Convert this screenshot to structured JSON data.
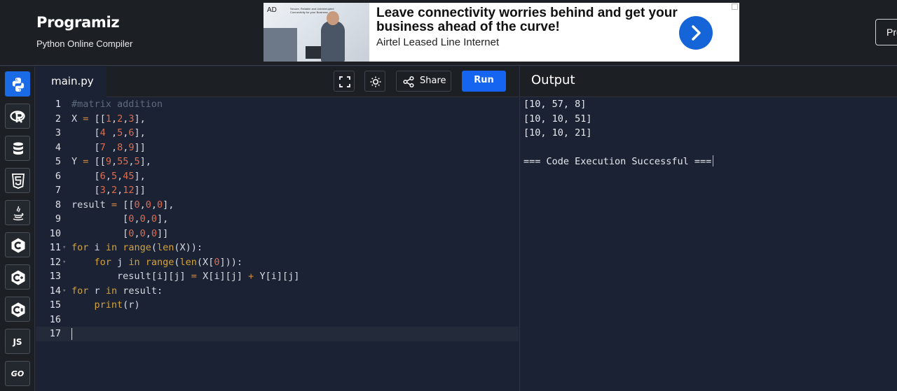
{
  "header": {
    "logo": "Programiz",
    "subtitle": "Python Online Compiler",
    "pro_button": "Pro"
  },
  "ad": {
    "tag": "AD",
    "headline": "Leave connectivity worries behind and get your business ahead of the curve!",
    "subline": "Airtel Leased Line Internet",
    "image_text": "Secure, Reliable and Uninterrupted Connectivity for your Business"
  },
  "sidebar": {
    "items": [
      {
        "name": "python",
        "icon": "python-icon",
        "label": ""
      },
      {
        "name": "r",
        "icon": "r-icon",
        "label": ""
      },
      {
        "name": "sql",
        "icon": "database-icon",
        "label": ""
      },
      {
        "name": "html",
        "icon": "html5-icon",
        "label": ""
      },
      {
        "name": "java",
        "icon": "java-icon",
        "label": ""
      },
      {
        "name": "c",
        "icon": "c-icon",
        "label": ""
      },
      {
        "name": "cpp",
        "icon": "cpp-icon",
        "label": ""
      },
      {
        "name": "csharp",
        "icon": "csharp-icon",
        "label": ""
      },
      {
        "name": "js",
        "icon": "js-icon",
        "label": "JS"
      },
      {
        "name": "go",
        "icon": "go-icon",
        "label": "GO"
      }
    ]
  },
  "editor": {
    "file_tab": "main.py",
    "share_label": "Share",
    "run_label": "Run",
    "line_numbers": [
      "1",
      "2",
      "3",
      "4",
      "5",
      "6",
      "7",
      "8",
      "9",
      "10",
      "11",
      "12",
      "13",
      "14",
      "15",
      "16",
      "17"
    ],
    "code_lines": [
      "#matrix addition",
      "X = [[1,2,3],",
      "    [4 ,5,6],",
      "    [7 ,8,9]]",
      "Y = [[9,55,5],",
      "    [6,5,45],",
      "    [3,2,12]]",
      "result = [[0,0,0],",
      "         [0,0,0],",
      "         [0,0,0]]",
      "for i in range(len(X)):",
      "    for j in range(len(X[0])):",
      "        result[i][j] = X[i][j] + Y[i][j]",
      "for r in result:",
      "    print(r)",
      "",
      ""
    ],
    "fold_lines": [
      11,
      12,
      14
    ],
    "current_line": 17
  },
  "output": {
    "title": "Output",
    "lines": [
      "[10, 57, 8]",
      "[10, 10, 51]",
      "[10, 10, 21]",
      "",
      "=== Code Execution Successful ==="
    ]
  },
  "colors": {
    "comment": "#5f6b7f",
    "keyword": "#d4a23a",
    "number": "#e06c50",
    "operator": "#d88a3a",
    "text": "#d6dae2",
    "accent": "#1565f0"
  }
}
